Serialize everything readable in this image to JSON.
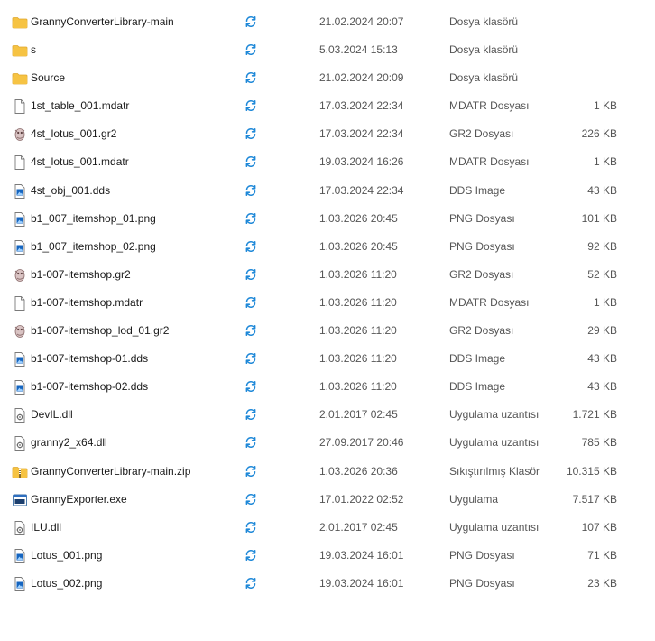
{
  "files": [
    {
      "name": "GrannyConverterLibrary-main",
      "date": "21.02.2024 20:07",
      "type": "Dosya klasörü",
      "size": "",
      "icon": "folder-icon"
    },
    {
      "name": "s",
      "date": "5.03.2024 15:13",
      "type": "Dosya klasörü",
      "size": "",
      "icon": "folder-icon"
    },
    {
      "name": "Source",
      "date": "21.02.2024 20:09",
      "type": "Dosya klasörü",
      "size": "",
      "icon": "folder-icon"
    },
    {
      "name": "1st_table_001.mdatr",
      "date": "17.03.2024 22:34",
      "type": "MDATR Dosyası",
      "size": "1 KB",
      "icon": "file-icon"
    },
    {
      "name": "4st_lotus_001.gr2",
      "date": "17.03.2024 22:34",
      "type": "GR2 Dosyası",
      "size": "226 KB",
      "icon": "gr2-icon"
    },
    {
      "name": "4st_lotus_001.mdatr",
      "date": "19.03.2024 16:26",
      "type": "MDATR Dosyası",
      "size": "1 KB",
      "icon": "file-icon"
    },
    {
      "name": "4st_obj_001.dds",
      "date": "17.03.2024 22:34",
      "type": "DDS Image",
      "size": "43 KB",
      "icon": "image-icon"
    },
    {
      "name": "b1_007_itemshop_01.png",
      "date": "1.03.2026 20:45",
      "type": "PNG Dosyası",
      "size": "101 KB",
      "icon": "image-icon"
    },
    {
      "name": "b1_007_itemshop_02.png",
      "date": "1.03.2026 20:45",
      "type": "PNG Dosyası",
      "size": "92 KB",
      "icon": "image-icon"
    },
    {
      "name": "b1-007-itemshop.gr2",
      "date": "1.03.2026 11:20",
      "type": "GR2 Dosyası",
      "size": "52 KB",
      "icon": "gr2-icon"
    },
    {
      "name": "b1-007-itemshop.mdatr",
      "date": "1.03.2026 11:20",
      "type": "MDATR Dosyası",
      "size": "1 KB",
      "icon": "file-icon"
    },
    {
      "name": "b1-007-itemshop_lod_01.gr2",
      "date": "1.03.2026 11:20",
      "type": "GR2 Dosyası",
      "size": "29 KB",
      "icon": "gr2-icon"
    },
    {
      "name": "b1-007-itemshop-01.dds",
      "date": "1.03.2026 11:20",
      "type": "DDS Image",
      "size": "43 KB",
      "icon": "image-icon"
    },
    {
      "name": "b1-007-itemshop-02.dds",
      "date": "1.03.2026 11:20",
      "type": "DDS Image",
      "size": "43 KB",
      "icon": "image-icon"
    },
    {
      "name": "DevIL.dll",
      "date": "2.01.2017 02:45",
      "type": "Uygulama uzantısı",
      "size": "1.721 KB",
      "icon": "dll-icon"
    },
    {
      "name": "granny2_x64.dll",
      "date": "27.09.2017 20:46",
      "type": "Uygulama uzantısı",
      "size": "785 KB",
      "icon": "dll-icon"
    },
    {
      "name": "GrannyConverterLibrary-main.zip",
      "date": "1.03.2026 20:36",
      "type": "Sıkıştırılmış Klasör",
      "size": "10.315 KB",
      "icon": "zip-folder-icon"
    },
    {
      "name": "GrannyExporter.exe",
      "date": "17.01.2022 02:52",
      "type": "Uygulama",
      "size": "7.517 KB",
      "icon": "exe-icon"
    },
    {
      "name": "ILU.dll",
      "date": "2.01.2017 02:45",
      "type": "Uygulama uzantısı",
      "size": "107 KB",
      "icon": "dll-icon"
    },
    {
      "name": "Lotus_001.png",
      "date": "19.03.2024 16:01",
      "type": "PNG Dosyası",
      "size": "71 KB",
      "icon": "image-icon"
    },
    {
      "name": "Lotus_002.png",
      "date": "19.03.2024 16:01",
      "type": "PNG Dosyası",
      "size": "23 KB",
      "icon": "image-icon"
    }
  ],
  "colors": {
    "sync": "#1e88d8",
    "folder": "#f6c343",
    "folder_dark": "#e0a82e",
    "image": "#1565c0"
  }
}
